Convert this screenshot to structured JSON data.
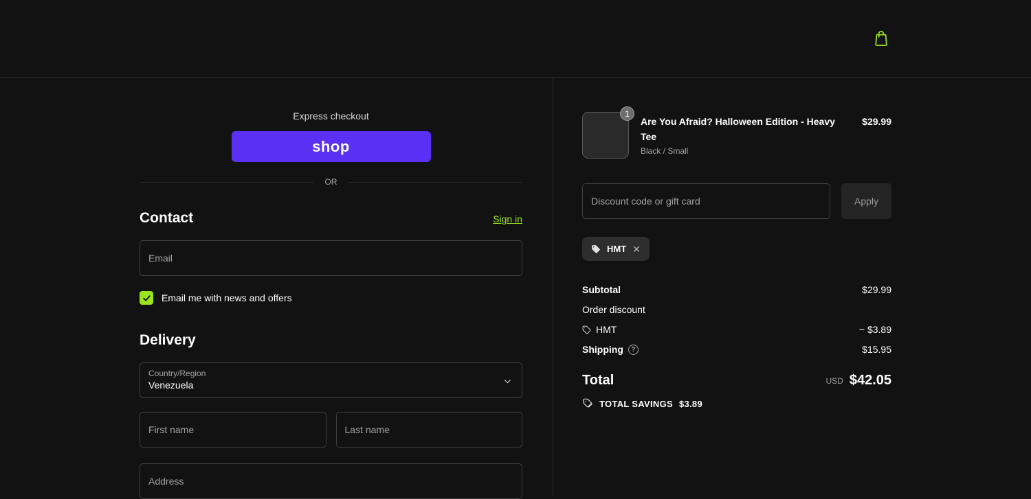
{
  "colors": {
    "accent": "#9be31c",
    "shop_purple": "#5a31f4",
    "background": "#121212"
  },
  "header": {
    "cart_icon": "bag-icon"
  },
  "express": {
    "label": "Express checkout",
    "shop_button_label": "shop",
    "or_divider": "OR"
  },
  "contact": {
    "heading": "Contact",
    "sign_in_link": "Sign in",
    "email_placeholder": "Email",
    "newsletter_label": "Email me with news and offers",
    "newsletter_checked": true
  },
  "delivery": {
    "heading": "Delivery",
    "country_label": "Country/Region",
    "country_value": "Venezuela",
    "first_name_placeholder": "First name",
    "last_name_placeholder": "Last name",
    "address_placeholder": "Address"
  },
  "order": {
    "item": {
      "quantity": "1",
      "title": "Are You Afraid? Halloween Edition - Heavy Tee",
      "variant": "Black / Small",
      "price": "$29.99"
    },
    "discount": {
      "placeholder": "Discount code or gift card",
      "apply_label": "Apply",
      "chip_code": "HMT",
      "chip_close": "✕"
    },
    "summary": {
      "subtotal_label": "Subtotal",
      "subtotal_value": "$29.99",
      "discount_label": "Order discount",
      "discount_code": "HMT",
      "discount_value": "− $3.89",
      "shipping_label": "Shipping",
      "shipping_help": "?",
      "shipping_value": "$15.95",
      "total_label": "Total",
      "currency": "USD",
      "total_value": "$42.05",
      "savings_label": "TOTAL SAVINGS",
      "savings_value": "$3.89"
    }
  }
}
